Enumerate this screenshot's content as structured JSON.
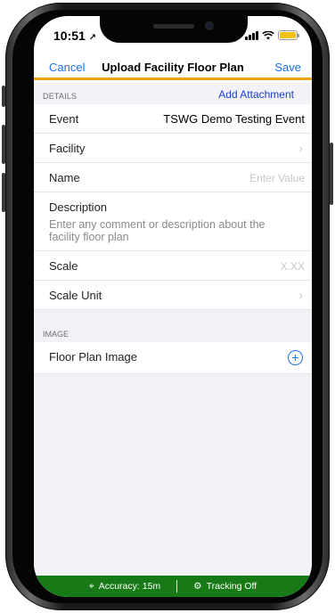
{
  "status_bar": {
    "time": "10:51",
    "location_icon": "location-arrow-icon",
    "battery_color": "#f2c418"
  },
  "nav": {
    "cancel_label": "Cancel",
    "title": "Upload Facility Floor Plan",
    "save_label": "Save",
    "accent_color": "#f0a30a"
  },
  "details": {
    "header": "DETAILS",
    "action_label": "Add Attachment",
    "rows": [
      {
        "label": "Event",
        "value": "TSWG Demo Testing Event"
      },
      {
        "label": "Facility",
        "value": ""
      },
      {
        "label": "Name",
        "placeholder": "Enter Value"
      },
      {
        "label": "Description",
        "placeholder": "Enter any comment or description about the facility floor plan"
      },
      {
        "label": "Scale",
        "placeholder": "X.XX"
      },
      {
        "label": "Scale Unit",
        "value": ""
      }
    ]
  },
  "image": {
    "header": "IMAGE",
    "row_label": "Floor Plan Image"
  },
  "bottom_bar": {
    "accuracy": "Accuracy: 15m",
    "tracking": "Tracking Off",
    "color": "#177a17"
  }
}
